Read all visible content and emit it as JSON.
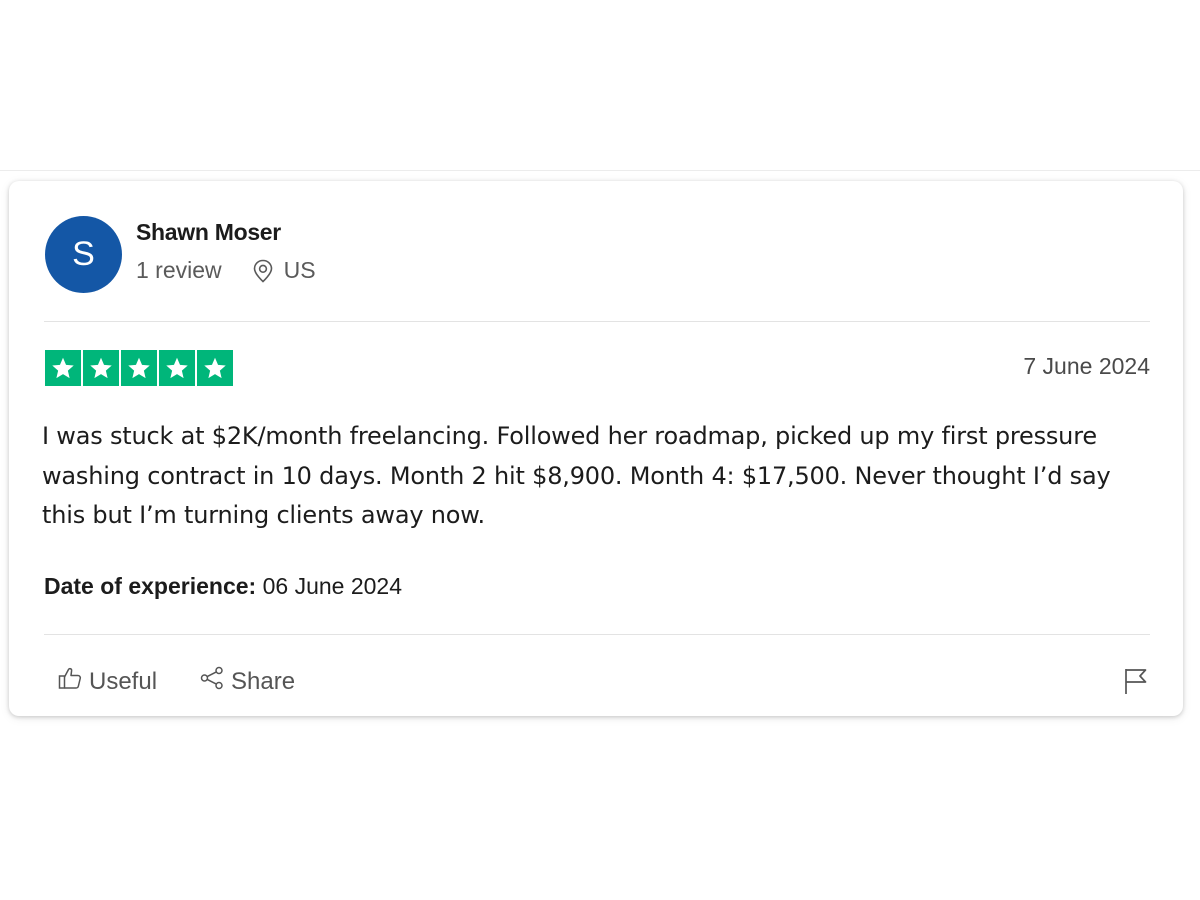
{
  "reviewer": {
    "avatar_initial": "S",
    "avatar_color": "#1457a6",
    "name": "Shawn Moser",
    "review_count": "1 review",
    "location_icon": "map-pin-icon",
    "country": "US"
  },
  "rating": {
    "stars": 5,
    "max_stars": 5,
    "star_color": "#00b67a"
  },
  "review": {
    "date": "7 June 2024",
    "body": "I was stuck at $2K/month freelancing. Followed her roadmap, picked up my first pressure washing contract in 10 days. Month 2 hit $8,900. Month 4: $17,500. Never thought I’d say this but I’m turning clients away now.",
    "experience_label": "Date of experience:",
    "experience_date": "06 June 2024"
  },
  "actions": {
    "useful_label": "Useful",
    "useful_icon": "thumbs-up-icon",
    "share_label": "Share",
    "share_icon": "share-icon",
    "report_icon": "flag-icon"
  }
}
